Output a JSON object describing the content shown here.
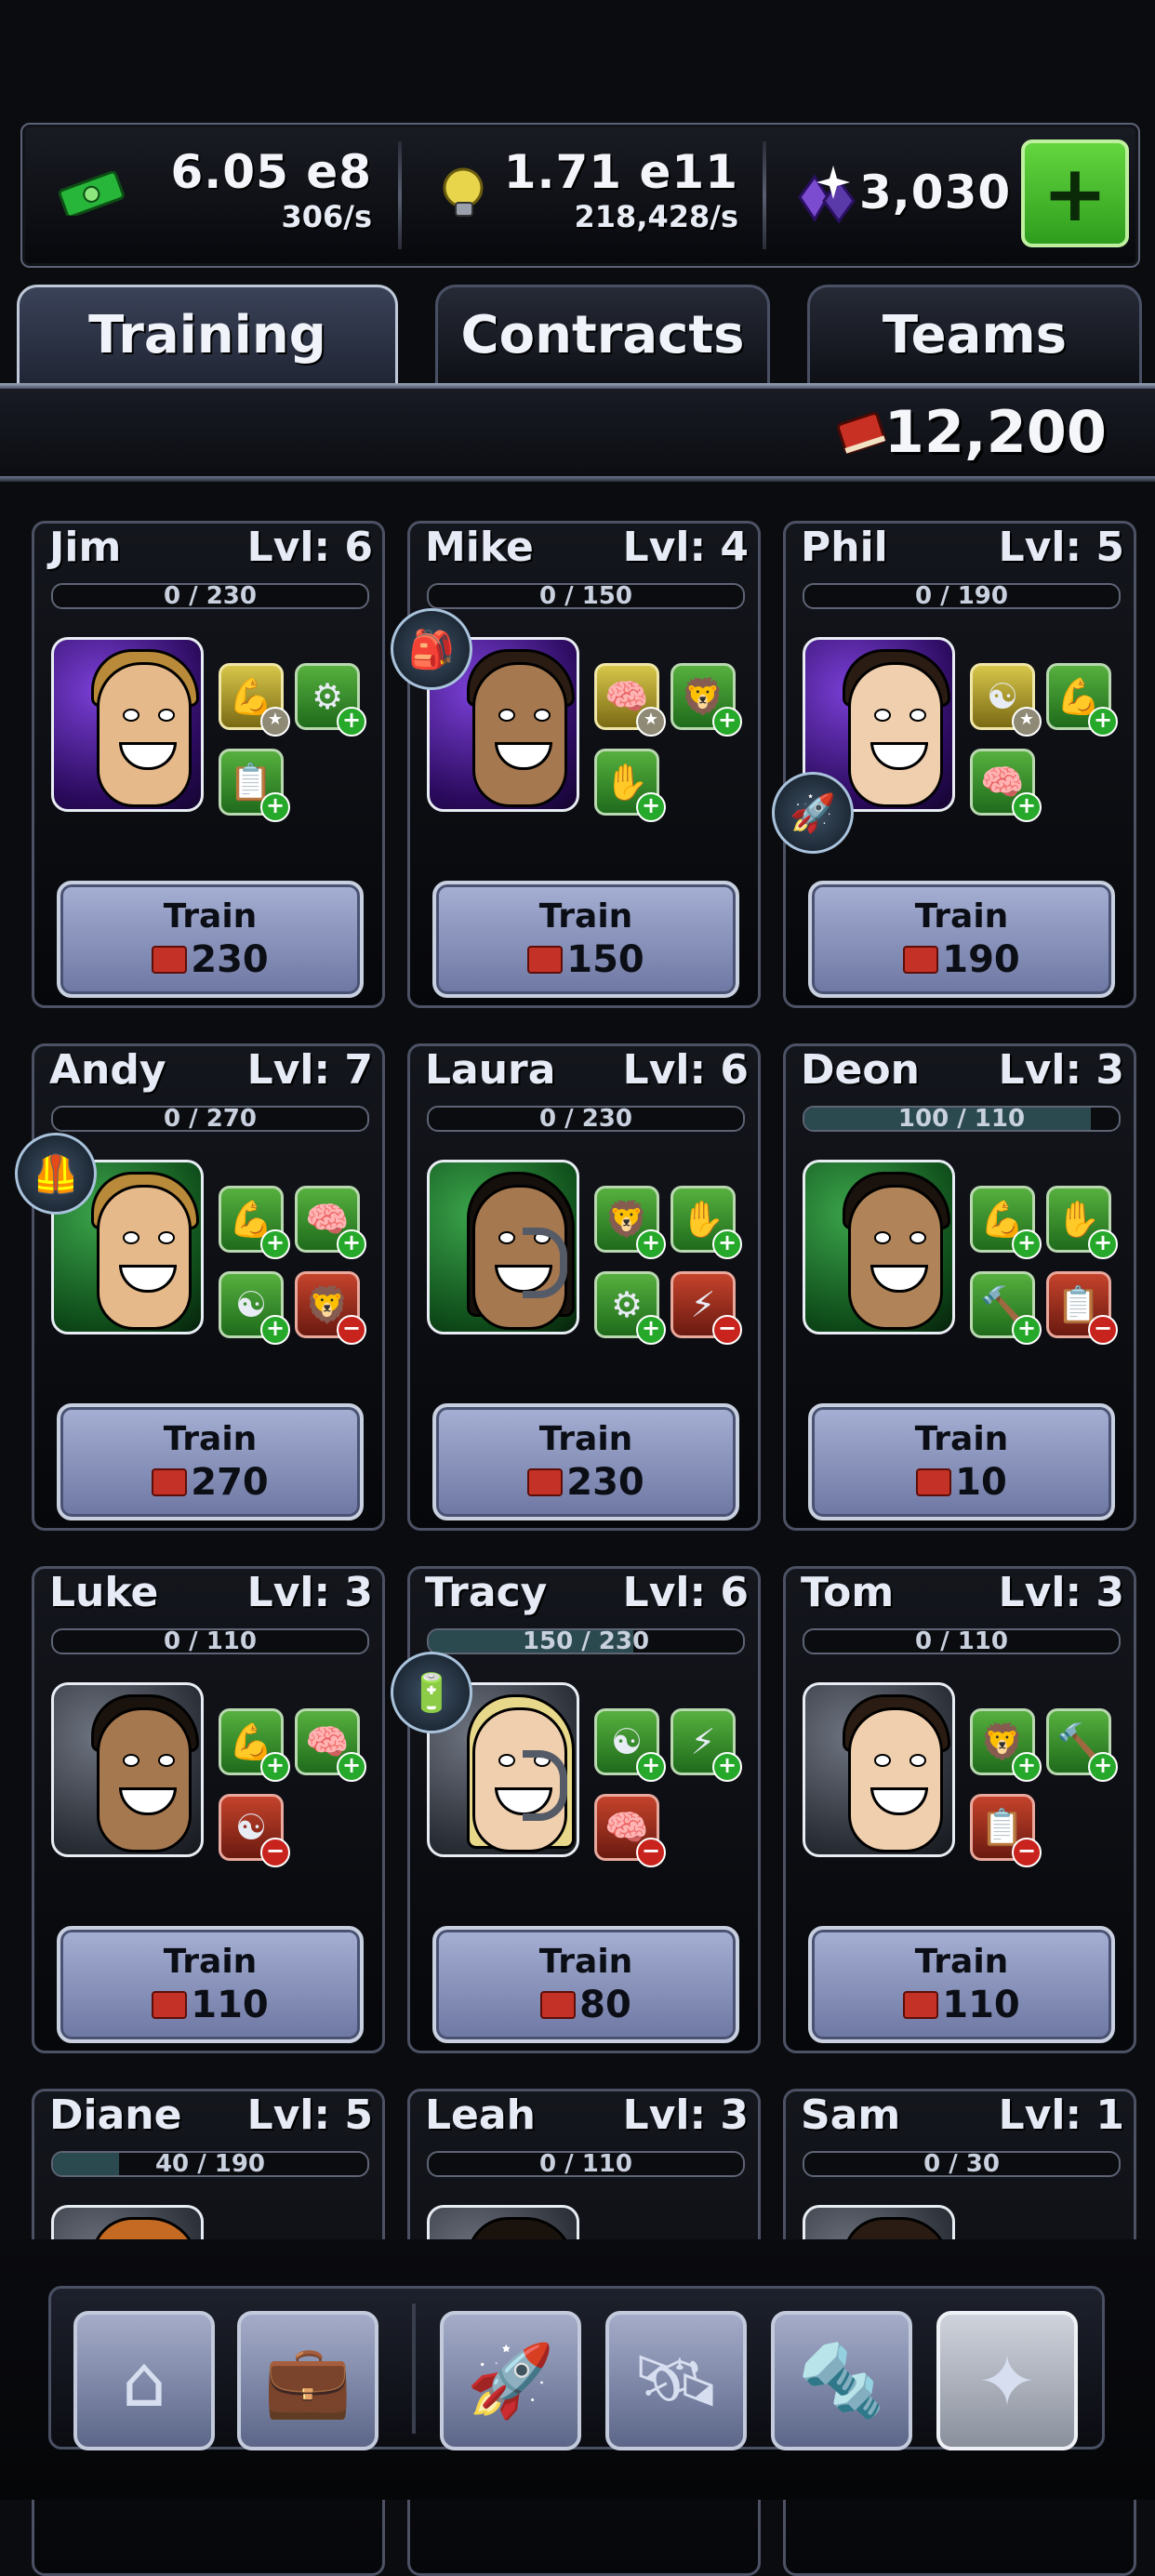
{
  "resources": {
    "cash": {
      "icon": "cash-icon",
      "amount": "6.05 e8",
      "rate": "306/s"
    },
    "research": {
      "icon": "lightbulb-icon",
      "amount": "1.71 e11",
      "rate": "218,428/s"
    },
    "crystals": {
      "icon": "crystal-icon",
      "amount": "3,030"
    },
    "add_label": "+"
  },
  "tabs": [
    {
      "label": "Training",
      "active": true
    },
    {
      "label": "Contracts",
      "active": false
    },
    {
      "label": "Teams",
      "active": false
    }
  ],
  "training_books": "12,200",
  "cards": [
    {
      "name": "Jim",
      "level": "Lvl: 6",
      "xp": "0 / 230",
      "xp_fraction": 0,
      "portrait": "purple",
      "train_label": "Train",
      "cost": "230"
    },
    {
      "name": "Mike",
      "level": "Lvl: 4",
      "xp": "0 / 150",
      "xp_fraction": 0,
      "portrait": "purple",
      "train_label": "Train",
      "cost": "150"
    },
    {
      "name": "Phil",
      "level": "Lvl: 5",
      "xp": "0 / 190",
      "xp_fraction": 0,
      "portrait": "purple",
      "train_label": "Train",
      "cost": "190"
    },
    {
      "name": "Andy",
      "level": "Lvl: 7",
      "xp": "0 / 270",
      "xp_fraction": 0,
      "portrait": "green",
      "train_label": "Train",
      "cost": "270"
    },
    {
      "name": "Laura",
      "level": "Lvl: 6",
      "xp": "0 / 230",
      "xp_fraction": 0,
      "portrait": "green",
      "train_label": "Train",
      "cost": "230"
    },
    {
      "name": "Deon",
      "level": "Lvl: 3",
      "xp": "100 / 110",
      "xp_fraction": 0.91,
      "portrait": "green",
      "train_label": "Train",
      "cost": "10"
    },
    {
      "name": "Luke",
      "level": "Lvl: 3",
      "xp": "0 / 110",
      "xp_fraction": 0,
      "portrait": "grey",
      "train_label": "Train",
      "cost": "110"
    },
    {
      "name": "Tracy",
      "level": "Lvl: 6",
      "xp": "150 / 230",
      "xp_fraction": 0.65,
      "portrait": "grey",
      "train_label": "Train",
      "cost": "80"
    },
    {
      "name": "Tom",
      "level": "Lvl: 3",
      "xp": "0 / 110",
      "xp_fraction": 0,
      "portrait": "grey",
      "train_label": "Train",
      "cost": "110"
    },
    {
      "name": "Diane",
      "level": "Lvl: 5",
      "xp": "40 / 190",
      "xp_fraction": 0.21,
      "portrait": "grey"
    },
    {
      "name": "Leah",
      "level": "Lvl: 3",
      "xp": "0 / 110",
      "xp_fraction": 0,
      "portrait": "grey"
    },
    {
      "name": "Sam",
      "level": "Lvl: 1",
      "xp": "0 / 30",
      "xp_fraction": 0,
      "portrait": "grey"
    }
  ],
  "nav": [
    {
      "icon": "home-icon"
    },
    {
      "icon": "briefcase-icon"
    },
    {
      "icon": "rocket-icon"
    },
    {
      "icon": "satellite-icon"
    },
    {
      "icon": "drill-icon"
    },
    {
      "icon": "shuriken-icon",
      "active": true
    }
  ]
}
